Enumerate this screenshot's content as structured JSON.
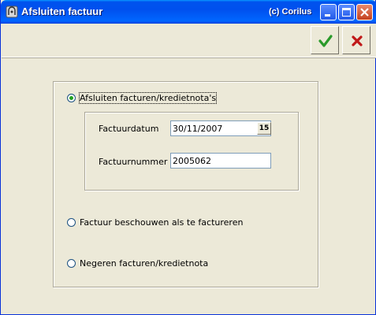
{
  "window": {
    "title": "Afsluiten factuur",
    "copyright": "(c) Corilus"
  },
  "toolbar": {
    "confirm_icon": "checkmark-icon",
    "cancel_icon": "cross-icon"
  },
  "options": [
    {
      "label": "Afsluiten facturen/kredietnota's",
      "selected": true
    },
    {
      "label": "Factuur beschouwen als te factureren",
      "selected": false
    },
    {
      "label": "Negeren facturen/kredietnota",
      "selected": false
    }
  ],
  "form": {
    "factuurdatum_label": "Factuurdatum",
    "factuurdatum_value": "30/11/2007",
    "calendar_text": "15",
    "factuurnummer_label": "Factuurnummer",
    "factuurnummer_value": "2005062"
  },
  "colors": {
    "titlebar": "#0053ee",
    "dialog_bg": "#ece9d8",
    "confirm": "#2a9a2a",
    "cancel": "#c01818"
  }
}
